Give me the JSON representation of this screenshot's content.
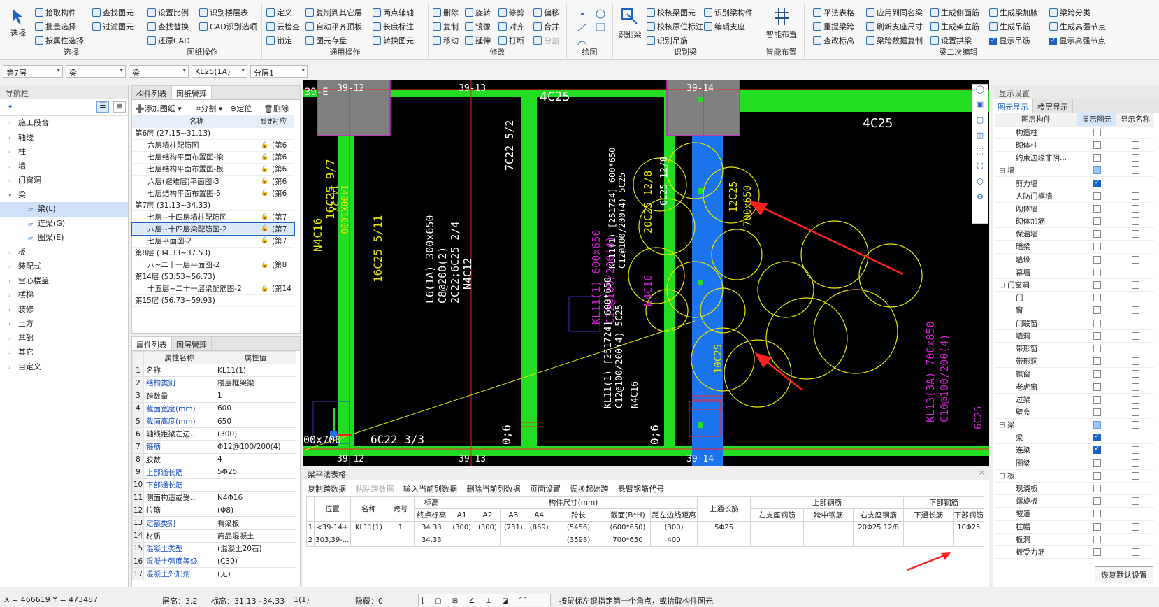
{
  "ribbon": {
    "select": {
      "big": "选择",
      "items": [
        "拾取构件",
        "批量选择",
        "按属性选择",
        "查找图元",
        "过滤图元"
      ],
      "title": "选择"
    },
    "cad": {
      "items": [
        "设置比例",
        "查找替换",
        "还原CAD",
        "识别楼层表",
        "CAD识别选项"
      ],
      "title": "图纸操作"
    },
    "common": {
      "items": [
        "定义",
        "云检查",
        "锁定",
        "复制到其它层",
        "自动平齐顶板",
        "图元存盘",
        "两点辅轴",
        "长度标注",
        "转换图元"
      ],
      "title": "通用操作"
    },
    "modify": {
      "items": [
        "删除",
        "复制",
        "移动",
        "旋转",
        "镜像",
        "延伸",
        "修剪",
        "对齐",
        "打断",
        "偏移",
        "合并",
        "分割"
      ],
      "title": "修改"
    },
    "draw": {
      "title": "绘图"
    },
    "identify": {
      "big": "识别梁",
      "items": [
        "校核梁图元",
        "校核原位标注",
        "识别吊筋",
        "识别梁构件",
        "编辑支座"
      ],
      "title": "识别梁"
    },
    "smart": {
      "big": "智能布置",
      "title": "智能布置"
    },
    "beam2": {
      "items": [
        "平法表格",
        "重提梁跨",
        "查改标高",
        "应用到同名梁",
        "刷新支座尺寸",
        "梁跨数据复制",
        "生成侧面筋",
        "生成架立筋",
        "设置拱梁",
        "生成梁加腋",
        "生成吊筋",
        "显示吊筋",
        "梁跨分类",
        "生成高强节点",
        "显示高强节点"
      ],
      "title": "梁二次编辑"
    }
  },
  "toolbar2": {
    "floor": "第7层",
    "type1": "梁",
    "type2": "梁",
    "member": "KL25(1A)",
    "layer": "分层1"
  },
  "nav": {
    "title": "导航栏",
    "items": [
      "施工段合",
      "轴线",
      "柱",
      "墙",
      "门窗洞",
      "梁",
      "梁(L)",
      "连梁(G)",
      "圈梁(E)",
      "板",
      "装配式",
      "空心楼盖",
      "楼梯",
      "装修",
      "土方",
      "基础",
      "其它",
      "自定义"
    ]
  },
  "drawings": {
    "tabs": [
      "构件列表",
      "图纸管理"
    ],
    "add": "添加图纸",
    "split": "分割",
    "locate": "定位",
    "delete": "删除",
    "col_name": "名称",
    "col_lock": "锁定",
    "col_map": "对应",
    "rows": [
      {
        "name": "第6层 (27.15~31.13)",
        "lock": "",
        "map": ""
      },
      {
        "name": "六层墙柱配筋图",
        "lock": "🔒",
        "map": "(第6"
      },
      {
        "name": "七层结构平面布置图-梁",
        "lock": "🔒",
        "map": "(第6"
      },
      {
        "name": "七层结构平面布置图-板",
        "lock": "🔒",
        "map": "(第6"
      },
      {
        "name": "六层(避难层)平面图-3",
        "lock": "🔒",
        "map": "(第6"
      },
      {
        "name": "七层结构平面布置图-5",
        "lock": "🔒",
        "map": "(第6"
      },
      {
        "name": "第7层 (31.13~34.33)",
        "lock": "",
        "map": ""
      },
      {
        "name": "七层~十四层墙柱配筋图",
        "lock": "🔒",
        "map": "(第7"
      },
      {
        "name": "八层~十四层梁配筋图-2",
        "lock": "🔒",
        "map": "(第7"
      },
      {
        "name": "七层平面图-2",
        "lock": "🔒",
        "map": "(第7"
      },
      {
        "name": "第8层 (34.33~37.53)",
        "lock": "",
        "map": ""
      },
      {
        "name": "八~二十一层平面图-2",
        "lock": "🔒",
        "map": "(第8"
      },
      {
        "name": "第14层 (53.53~56.73)",
        "lock": "",
        "map": ""
      },
      {
        "name": "十五层~二十一层梁配筋图-2",
        "lock": "🔒",
        "map": "(第14"
      },
      {
        "name": "第15层 (56.73~59.93)",
        "lock": "",
        "map": ""
      }
    ]
  },
  "props": {
    "tabs": [
      "属性列表",
      "图层管理"
    ],
    "col_name": "属性名称",
    "col_val": "属性值",
    "rows": [
      [
        "1",
        "名称",
        "KL11(1)"
      ],
      [
        "2",
        "结构类别",
        "楼层框架梁"
      ],
      [
        "3",
        "跨数量",
        "1"
      ],
      [
        "4",
        "截面宽度(mm)",
        "600"
      ],
      [
        "5",
        "截面高度(mm)",
        "650"
      ],
      [
        "6",
        "轴线距梁左边...",
        "(300)"
      ],
      [
        "7",
        "箍筋",
        "Φ12@100/200(4)"
      ],
      [
        "8",
        "胶数",
        "4"
      ],
      [
        "9",
        "上部通长筋",
        "5Φ25"
      ],
      [
        "10",
        "下部通长筋",
        ""
      ],
      [
        "11",
        "侧面构造或受...",
        "N4Φ16"
      ],
      [
        "12",
        "拉筋",
        "(Φ8)"
      ],
      [
        "13",
        "定额类别",
        "有梁板"
      ],
      [
        "14",
        "材质",
        "商品混凝土"
      ],
      [
        "15",
        "混凝土类型",
        "(混凝土20石)"
      ],
      [
        "16",
        "混凝土强度等级",
        "(C30)"
      ],
      [
        "17",
        "混凝土外加剂",
        "(无)"
      ]
    ]
  },
  "canvas": {
    "axis_labels": [
      "39-E",
      "39-12",
      "39-13",
      "39-14",
      "39-12",
      "39-13",
      "39-14"
    ],
    "texts": [
      "4C25",
      "4C25",
      "16C25 9/7",
      "N4C16",
      "16C25 5/11",
      "L6(1A) 300x650",
      "C8@200(2)",
      "2C22;6C25 2/4",
      "N4C12",
      "7C22 5/2",
      "1400X1600",
      "14.2X",
      "KL11(1) 600x650",
      "C12@100/200(4)",
      "N4C16",
      "20C25 12/8",
      "6C25 12/8",
      "12C25",
      "700x650",
      "10C25",
      "KL11(1) [251724] 600*650",
      "C12@100/200(4) 5C25",
      "KL11(1) [251724] 600*650",
      "C12@100/200(4) 5C25",
      "N4C16",
      "KL13(3A) 700x850",
      "C10@100/200(4)",
      "6C22 3/3",
      "0;6",
      "0;6",
      "00x700",
      "6C25"
    ]
  },
  "beamtable": {
    "title": "梁平法表格",
    "actions": [
      "复制跨数据",
      "粘贴跨数据",
      "输入当前列数据",
      "删除当前列数据",
      "页面设置",
      "调换起始跨",
      "悬臂钢筋代号"
    ],
    "headers": [
      "位置",
      "名称",
      "跨号",
      "标高",
      "终点标高",
      "A1",
      "A2",
      "A3",
      "A4",
      "跨长",
      "截面(B*H)",
      "距左边线距离",
      "上通长筋",
      "左支座钢筋",
      "跨中钢筋",
      "右支座钢筋",
      "下通长筋",
      "下部钢筋"
    ],
    "group_dims": "构件尺寸(mm)",
    "group_top": "上部钢筋",
    "group_bot": "下部钢筋",
    "rows": [
      {
        "n": "1",
        "pos": "<39-14+",
        "name": "KL11(1)",
        "span": "1",
        "end": "34.33",
        "a1": "(300)",
        "a2": "(300)",
        "a3": "(731)",
        "a4": "(869)",
        "len": "(5456)",
        "sec": "(600*650)",
        "dist": "(300)",
        "top": "5Φ25",
        "left": "",
        "mid": "",
        "right": "20Φ25 12/8",
        "bot": "",
        "botr": "10Φ25"
      },
      {
        "n": "2",
        "pos": "303,39-...",
        "name": "",
        "span": "",
        "end": "34.33",
        "a1": "",
        "a2": "",
        "a3": "",
        "a4": "",
        "len": "(3598)",
        "sec": "700*650",
        "dist": "400",
        "top": "",
        "left": "",
        "mid": "",
        "right": "",
        "bot": "",
        "botr": ""
      }
    ]
  },
  "display": {
    "title": "显示设置",
    "tabs": [
      "图元显示",
      "楼层显示"
    ],
    "col1": "图层构件",
    "col2": "显示图元",
    "col3": "显示名称",
    "rows": [
      {
        "name": "构造柱",
        "indent": 2,
        "a": 0,
        "b": 0
      },
      {
        "name": "砌体柱",
        "indent": 2,
        "a": 0,
        "b": 0
      },
      {
        "name": "约束边缘非阴...",
        "indent": 2,
        "a": 0,
        "b": 0
      },
      {
        "name": "墙",
        "indent": 1,
        "a": 2,
        "b": 0
      },
      {
        "name": "剪力墙",
        "indent": 2,
        "a": 1,
        "b": 0
      },
      {
        "name": "人防门框墙",
        "indent": 2,
        "a": 0,
        "b": 0
      },
      {
        "name": "砌体墙",
        "indent": 2,
        "a": 0,
        "b": 0
      },
      {
        "name": "砌体加筋",
        "indent": 2,
        "a": 0,
        "b": 0
      },
      {
        "name": "保温墙",
        "indent": 2,
        "a": 0,
        "b": 0
      },
      {
        "name": "暗梁",
        "indent": 2,
        "a": 0,
        "b": 0
      },
      {
        "name": "墙垛",
        "indent": 2,
        "a": 0,
        "b": 0
      },
      {
        "name": "幕墙",
        "indent": 2,
        "a": 0,
        "b": 0
      },
      {
        "name": "门窗洞",
        "indent": 1,
        "a": 0,
        "b": 0
      },
      {
        "name": "门",
        "indent": 2,
        "a": 0,
        "b": 0
      },
      {
        "name": "窗",
        "indent": 2,
        "a": 0,
        "b": 0
      },
      {
        "name": "门联窗",
        "indent": 2,
        "a": 0,
        "b": 0
      },
      {
        "name": "墙洞",
        "indent": 2,
        "a": 0,
        "b": 0
      },
      {
        "name": "带形窗",
        "indent": 2,
        "a": 0,
        "b": 0
      },
      {
        "name": "带形洞",
        "indent": 2,
        "a": 0,
        "b": 0
      },
      {
        "name": "飘窗",
        "indent": 2,
        "a": 0,
        "b": 0
      },
      {
        "name": "老虎窗",
        "indent": 2,
        "a": 0,
        "b": 0
      },
      {
        "name": "过梁",
        "indent": 2,
        "a": 0,
        "b": 0
      },
      {
        "name": "壁龛",
        "indent": 2,
        "a": 0,
        "b": 0
      },
      {
        "name": "梁",
        "indent": 1,
        "a": 2,
        "b": 0
      },
      {
        "name": "梁",
        "indent": 2,
        "a": 1,
        "b": 0
      },
      {
        "name": "连梁",
        "indent": 2,
        "a": 1,
        "b": 0
      },
      {
        "name": "圈梁",
        "indent": 2,
        "a": 0,
        "b": 0
      },
      {
        "name": "板",
        "indent": 1,
        "a": 0,
        "b": 0
      },
      {
        "name": "现浇板",
        "indent": 2,
        "a": 0,
        "b": 0
      },
      {
        "name": "螺旋板",
        "indent": 2,
        "a": 0,
        "b": 0
      },
      {
        "name": "坡道",
        "indent": 2,
        "a": 0,
        "b": 0
      },
      {
        "name": "柱帽",
        "indent": 2,
        "a": 0,
        "b": 0
      },
      {
        "name": "板洞",
        "indent": 2,
        "a": 0,
        "b": 0
      },
      {
        "name": "板受力筋",
        "indent": 2,
        "a": 0,
        "b": 0
      }
    ],
    "reset": "恢复默认设置"
  },
  "status": {
    "coords": "X = 466619 Y = 473487",
    "floor_h": "层高：3.2",
    "elev": "标高：31.13~34.33",
    "count": "1(1)",
    "hidden": "隐藏：0",
    "hint": "按鼠标左键指定第一个角点，或拾取构件图元"
  },
  "colors": {
    "green": "#22dd22",
    "blue": "#1c74f0",
    "magenta": "#d41cd4",
    "yellow": "#e8e800",
    "red": "#ff2020",
    "accent": "#1c62c8"
  }
}
